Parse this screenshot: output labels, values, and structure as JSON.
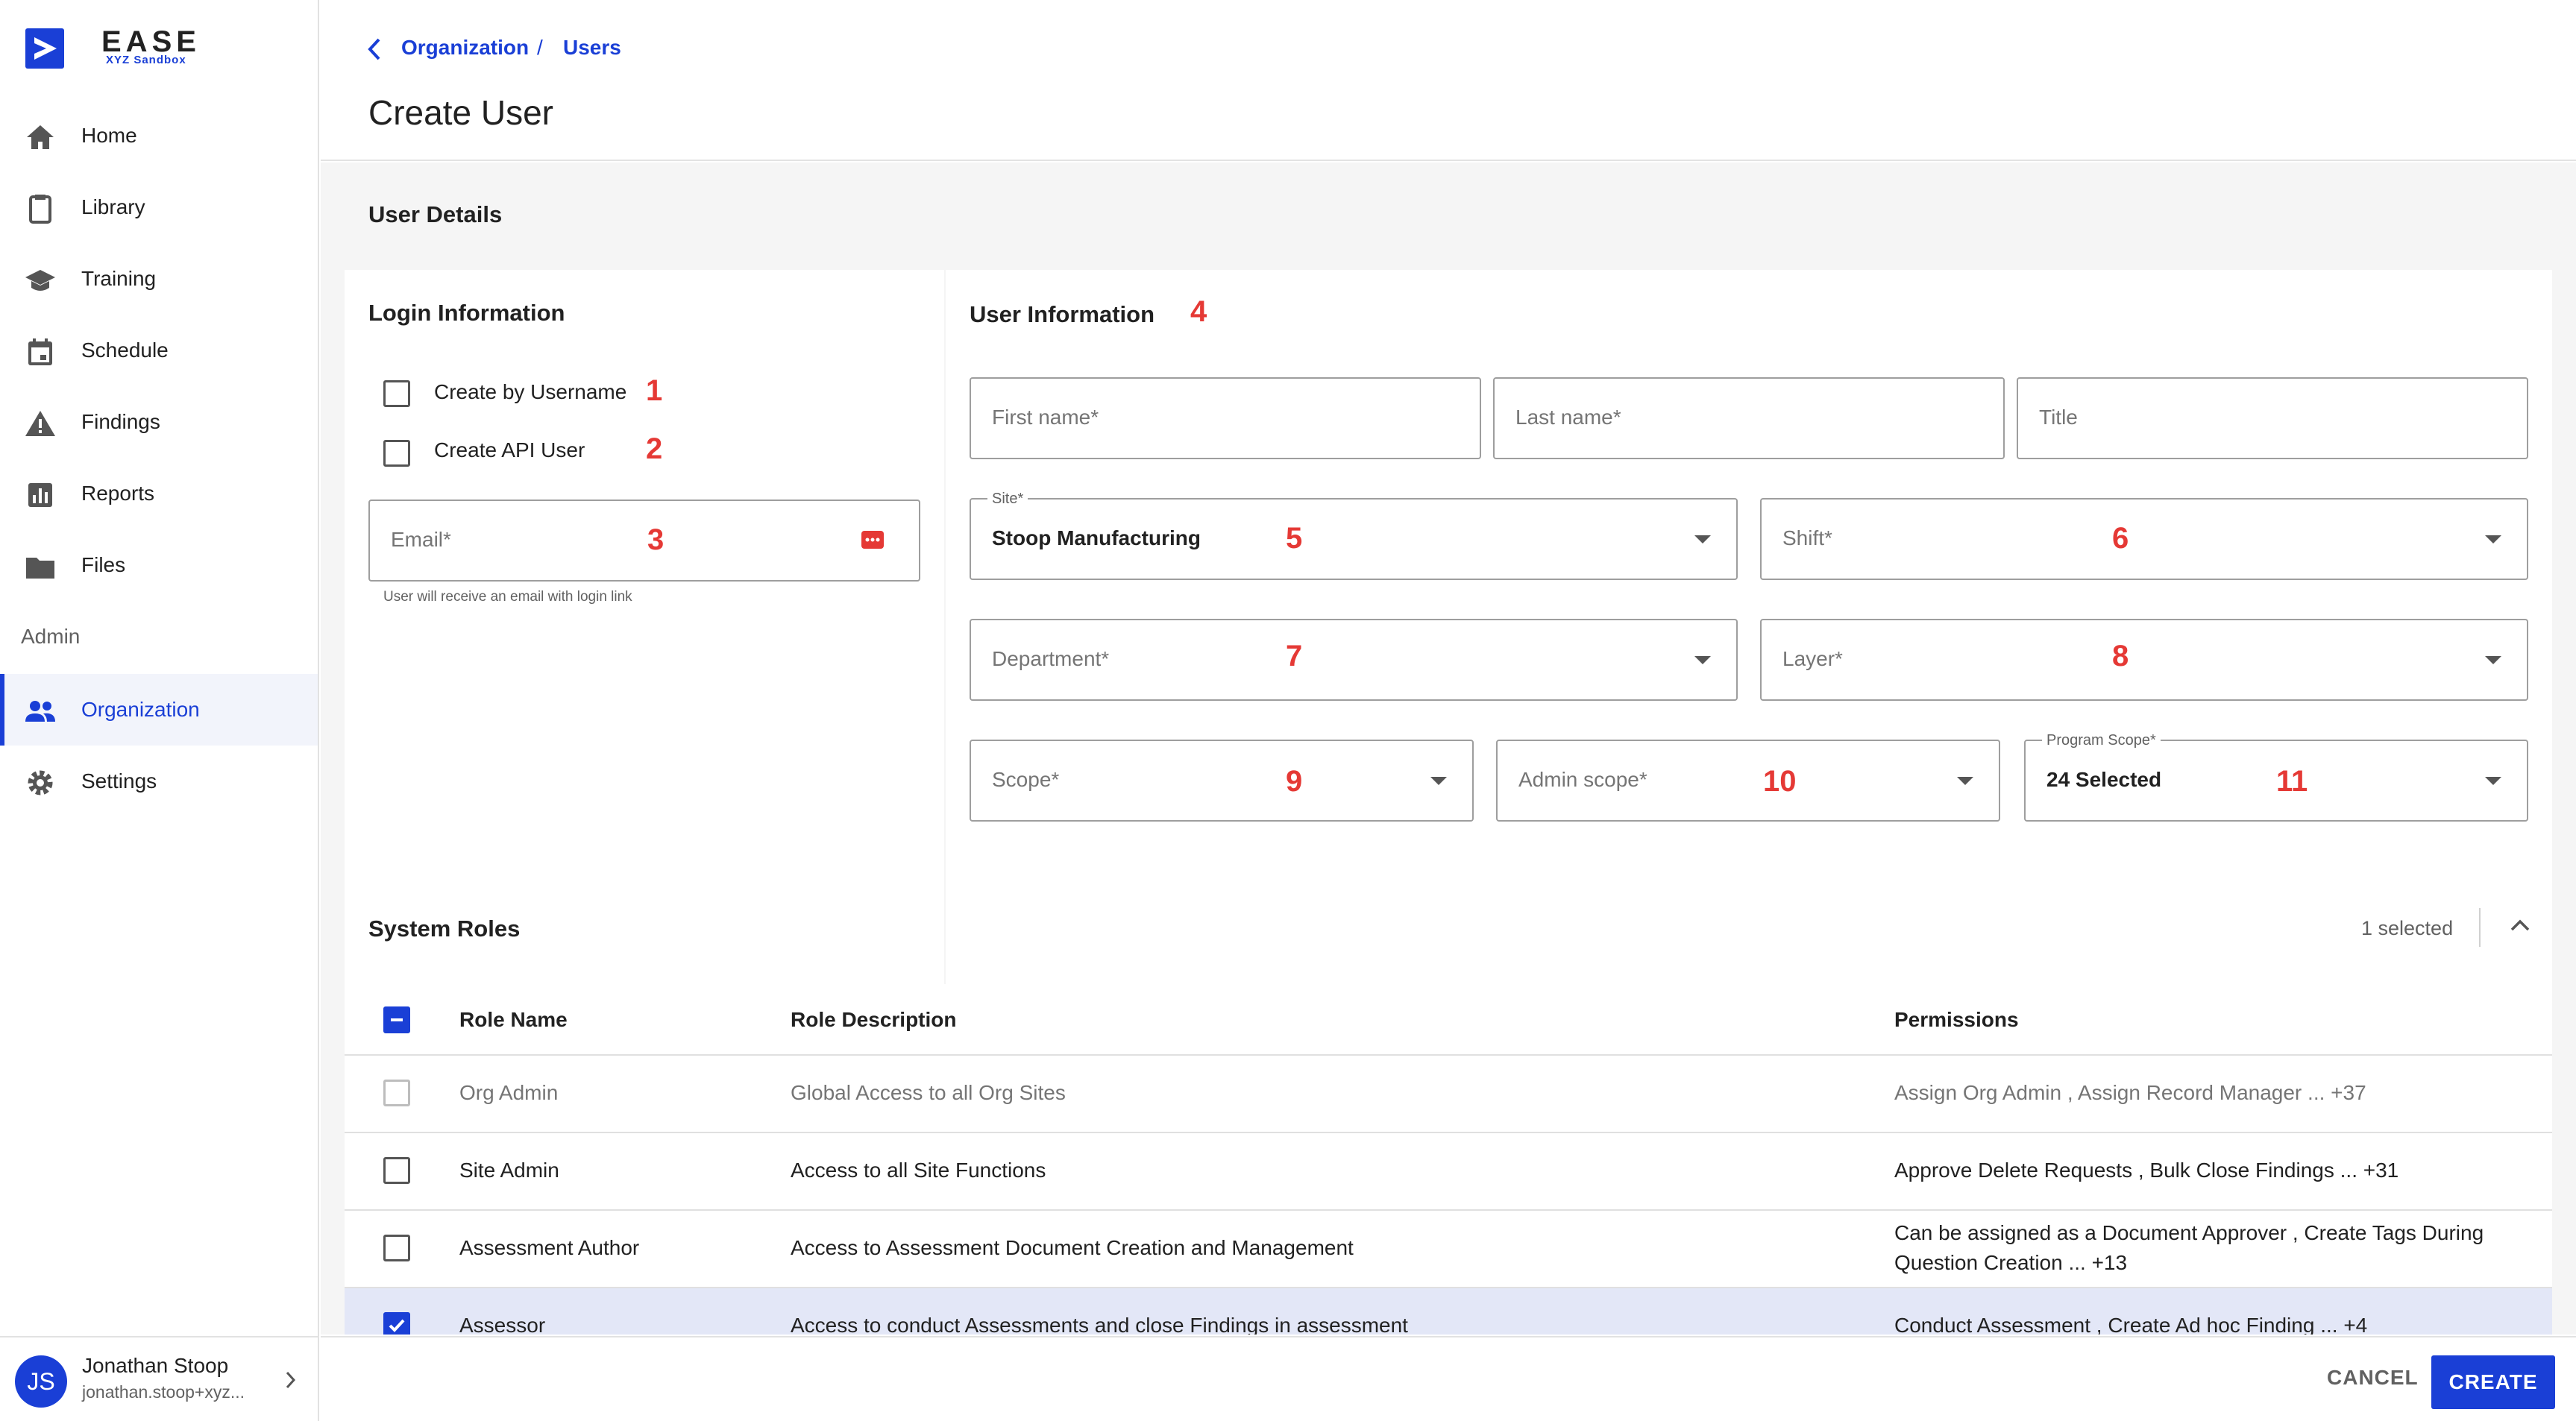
{
  "app": {
    "logo_text": "EASE",
    "logo_sub": "XYZ Sandbox"
  },
  "sidebar": {
    "items": [
      {
        "label": "Home",
        "icon": "home-icon"
      },
      {
        "label": "Library",
        "icon": "clipboard-icon"
      },
      {
        "label": "Training",
        "icon": "graduation-cap-icon"
      },
      {
        "label": "Schedule",
        "icon": "calendar-icon"
      },
      {
        "label": "Findings",
        "icon": "warning-icon"
      },
      {
        "label": "Reports",
        "icon": "bar-chart-icon"
      },
      {
        "label": "Files",
        "icon": "folder-icon"
      }
    ],
    "admin_label": "Admin",
    "admin_items": [
      {
        "label": "Organization",
        "icon": "people-icon",
        "active": true
      },
      {
        "label": "Settings",
        "icon": "gear-icon"
      }
    ],
    "user": {
      "initials": "JS",
      "name": "Jonathan Stoop",
      "email": "jonathan.stoop+xyz..."
    }
  },
  "header": {
    "breadcrumb": [
      "Organization",
      "Users"
    ],
    "separator": "/",
    "title": "Create User"
  },
  "user_details": {
    "heading": "User Details",
    "login": {
      "heading": "Login Information",
      "create_by_username": "Create by Username",
      "create_api_user": "Create API User",
      "email_placeholder": "Email*",
      "email_helper": "User will receive an email with login link"
    },
    "info": {
      "heading": "User Information",
      "first_name": "First name*",
      "last_name": "Last name*",
      "title": "Title",
      "site_legend": "Site*",
      "site_value": "Stoop Manufacturing",
      "shift": "Shift*",
      "department": "Department*",
      "layer": "Layer*",
      "scope": "Scope*",
      "admin_scope": "Admin scope*",
      "program_scope_legend": "Program Scope*",
      "program_scope_value": "24 Selected"
    },
    "annotations": [
      "1",
      "2",
      "3",
      "4",
      "5",
      "6",
      "7",
      "8",
      "9",
      "10",
      "11"
    ]
  },
  "system_roles": {
    "heading": "System Roles",
    "selected_count": "1 selected",
    "columns": [
      "Role Name",
      "Role Description",
      "Permissions"
    ],
    "rows": [
      {
        "name": "Org Admin",
        "description": "Global Access to all Org Sites",
        "permissions": "Assign Org Admin , Assign Record Manager ... +37",
        "checked": false,
        "disabled": true
      },
      {
        "name": "Site Admin",
        "description": "Access to all Site Functions",
        "permissions": "Approve Delete Requests , Bulk Close Findings ... +31",
        "checked": false
      },
      {
        "name": "Assessment Author",
        "description": "Access to Assessment Document Creation and Management",
        "permissions": "Can be assigned as a Document Approver , Create Tags During",
        "permissions2": "Question Creation ... +13",
        "checked": false
      },
      {
        "name": "Assessor",
        "description": "Access to conduct Assessments and close Findings in assessment",
        "permissions": "Conduct Assessment , Create Ad hoc Finding ... +4",
        "checked": true
      }
    ]
  },
  "footer": {
    "cancel": "CANCEL",
    "create": "CREATE"
  },
  "colors": {
    "accent": "#1a3fd6",
    "annotation": "#e53935",
    "selected_row": "#e3e7f7"
  }
}
